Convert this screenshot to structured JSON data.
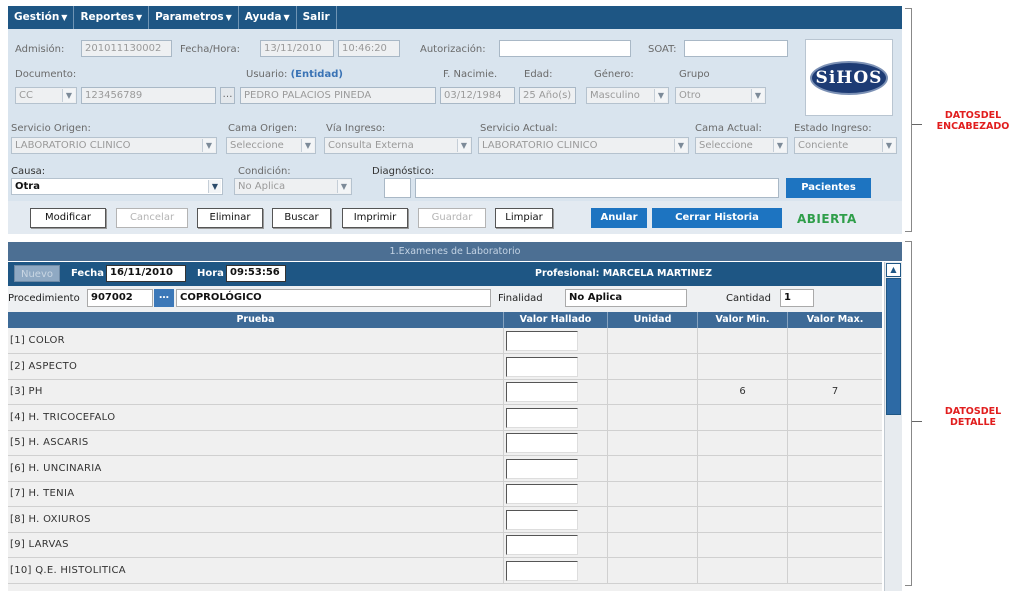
{
  "menu": [
    {
      "label": "Gestión",
      "has_dropdown": true
    },
    {
      "label": "Reportes",
      "has_dropdown": true
    },
    {
      "label": "Parametros",
      "has_dropdown": true
    },
    {
      "label": "Ayuda",
      "has_dropdown": true
    },
    {
      "label": "Salir",
      "has_dropdown": false
    }
  ],
  "header": {
    "admision_label": "Admisión:",
    "admision_value": "201011130002",
    "fecha_hora_label": "Fecha/Hora:",
    "fecha_value": "13/11/2010",
    "hora_value": "10:46:20",
    "autorizacion_label": "Autorización:",
    "autorizacion_value": "",
    "soat_label": "SOAT:",
    "soat_value": "",
    "documento_label": "Documento:",
    "documento_tipo": "CC",
    "documento_numero": "123456789",
    "usuario_label": "Usuario:",
    "usuario_entidad": "(Entidad)",
    "usuario_value": "PEDRO  PALACIOS PINEDA",
    "nacimiento_label": "F. Nacimie.",
    "nacimiento_value": "03/12/1984",
    "edad_label": "Edad:",
    "edad_value": "25 Año(s)",
    "genero_label": "Género:",
    "genero_value": "Masculino",
    "grupo_label": "Grupo",
    "grupo_value": "Otro",
    "servicio_origen_label": "Servicio Origen:",
    "servicio_origen_value": "LABORATORIO CLINICO",
    "cama_origen_label": "Cama Origen:",
    "cama_origen_value": "Seleccione",
    "via_ingreso_label": "Vía Ingreso:",
    "via_ingreso_value": "Consulta Externa",
    "servicio_actual_label": "Servicio Actual:",
    "servicio_actual_value": "LABORATORIO CLINICO",
    "cama_actual_label": "Cama Actual:",
    "cama_actual_value": "Seleccione",
    "estado_ingreso_label": "Estado Ingreso:",
    "estado_ingreso_value": "Conciente",
    "causa_label": "Causa:",
    "causa_value": "Otra",
    "condicion_label": "Condición:",
    "condicion_value": "No Aplica",
    "diagnostico_label": "Diagnóstico:",
    "diagnostico_code": "",
    "diagnostico_desc": "",
    "pacientes_button": "Pacientes",
    "logo_text": "SiHOS"
  },
  "actions": {
    "modificar": "Modificar",
    "cancelar": "Cancelar",
    "eliminar": "Eliminar",
    "buscar": "Buscar",
    "imprimir": "Imprimir",
    "guardar": "Guardar",
    "limpiar": "Limpiar",
    "anular": "Anular",
    "cerrar_historia": "Cerrar Historia",
    "status": "ABIERTA"
  },
  "detail": {
    "section_title": "1.Examenes de Laboratorio",
    "nuevo": "Nuevo",
    "fecha_label": "Fecha",
    "fecha_value": "16/11/2010",
    "hora_label": "Hora",
    "hora_value": "09:53:56",
    "profesional": "Profesional: MARCELA MARTINEZ",
    "procedimiento_label": "Procedimiento",
    "procedimiento_code": "907002",
    "procedimiento_desc": "COPROLÓGICO",
    "finalidad_label": "Finalidad",
    "finalidad_value": "No Aplica",
    "cantidad_label": "Cantidad",
    "cantidad_value": "1",
    "columns": [
      "Prueba",
      "Valor Hallado",
      "Unidad",
      "Valor Min.",
      "Valor Max."
    ],
    "rows": [
      {
        "prueba": "[1] COLOR",
        "valor": "",
        "unidad": "",
        "min": "",
        "max": ""
      },
      {
        "prueba": "[2] ASPECTO",
        "valor": "",
        "unidad": "",
        "min": "",
        "max": ""
      },
      {
        "prueba": "[3] PH",
        "valor": "",
        "unidad": "",
        "min": "6",
        "max": "7"
      },
      {
        "prueba": "[4] H. TRICOCEFALO",
        "valor": "",
        "unidad": "",
        "min": "",
        "max": ""
      },
      {
        "prueba": "[5] H. ASCARIS",
        "valor": "",
        "unidad": "",
        "min": "",
        "max": ""
      },
      {
        "prueba": "[6] H. UNCINARIA",
        "valor": "",
        "unidad": "",
        "min": "",
        "max": ""
      },
      {
        "prueba": "[7] H. TENIA",
        "valor": "",
        "unidad": "",
        "min": "",
        "max": ""
      },
      {
        "prueba": "[8] H. OXIUROS",
        "valor": "",
        "unidad": "",
        "min": "",
        "max": ""
      },
      {
        "prueba": "[9] LARVAS",
        "valor": "",
        "unidad": "",
        "min": "",
        "max": ""
      },
      {
        "prueba": "[10] Q.E. HISTOLITICA",
        "valor": "",
        "unidad": "",
        "min": "",
        "max": ""
      }
    ]
  },
  "annotations": {
    "encabezado": "DATOSDEL\nENCABEZADO",
    "detalle": "DATOSDEL\nDETALLE"
  },
  "colors": {
    "menu_bg": "#1e5684",
    "header_bg": "#d9e4ee",
    "accent_button": "#1d74c1",
    "status_green": "#2f9e4a",
    "annotation_red": "#e11d1d"
  }
}
